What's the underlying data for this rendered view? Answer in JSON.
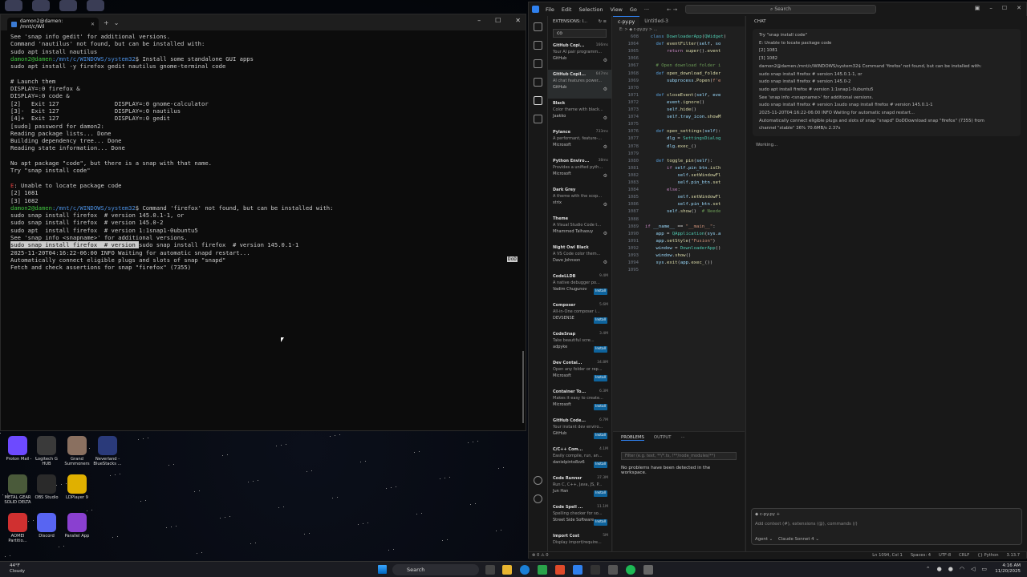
{
  "terminal": {
    "tab_title": "damon2@damen: /mnt/c/WIl",
    "lines": [
      {
        "t": "See 'snap info gedit' for additional versions."
      },
      {
        "t": "Command 'nautilus' not found, but can be installed with:"
      },
      {
        "t": "sudo apt install nautilus"
      },
      {
        "prompt": "damon2@damen",
        "path": ":/mnt/c/WINDOWS/system32",
        "cmd": "$ Install some standalone GUI apps"
      },
      {
        "t": "sudo apt install -y firefox gedit nautilus gnome-terminal code"
      },
      {
        "t": ""
      },
      {
        "t": "# Launch them"
      },
      {
        "t": "DISPLAY=:0 firefox &"
      },
      {
        "t": "DISPLAY=:0 code &"
      },
      {
        "t": "[2]   Exit 127                DISPLAY=:0 gnome-calculator"
      },
      {
        "t": "[3]-  Exit 127                DISPLAY=:0 nautilus"
      },
      {
        "t": "[4]+  Exit 127                DISPLAY=:0 gedit"
      },
      {
        "t": "[sudo] password for damon2:"
      },
      {
        "t": "Reading package lists... Done"
      },
      {
        "t": "Building dependency tree... Done"
      },
      {
        "t": "Reading state information... Done"
      },
      {
        "t": ""
      },
      {
        "t": "No apt package \"code\", but there is a snap with that name."
      },
      {
        "t": "Try \"snap install code\""
      },
      {
        "t": ""
      },
      {
        "err": "E",
        "t": ": Unable to locate package code"
      },
      {
        "t": "[2] 1081"
      },
      {
        "t": "[3] 1082"
      },
      {
        "prompt": "damon2@damen",
        "path": ":/mnt/c/WINDOWS/system32",
        "cmd": "$ Command 'firefox' not found, but can be installed with:"
      },
      {
        "t": "sudo snap install firefox  # version 145.0.1-1, or"
      },
      {
        "t": "sudo snap install firefox  # version 145.0-2"
      },
      {
        "t": "sudo apt  install firefox  # version 1:1snap1-0ubuntu5"
      },
      {
        "t": "See 'snap info <snapname>' for additional versions."
      },
      {
        "sel": "sudo snap install firefox  # version ",
        "t": "sudo snap install firefox  # version 145.0.1-1"
      },
      {
        "t": "2025-11-20T04:16:22-06:00 INFO Waiting for automatic snapd restart..."
      },
      {
        "t": "Automatically connect eligible plugs and slots of snap \"snapd\""
      },
      {
        "t": "Fetch and check assertions for snap \"firefox\" (7355)"
      }
    ],
    "dop_label": "DoD"
  },
  "desktop_icons": [
    {
      "label": "Proton Mail",
      "color": "#6d4aff"
    },
    {
      "label": "Logitech G HUB",
      "color": "#3a3a3a"
    },
    {
      "label": "Grand Summoners",
      "color": "#8a7060"
    },
    {
      "label": "Neverland - BlueStacks ...",
      "color": "#2a3a7a"
    },
    {
      "label": "METAL GEAR SOLID DELTA",
      "color": "#4a5a3a"
    },
    {
      "label": "OBS Studio",
      "color": "#2a2a2a"
    },
    {
      "label": "LDPlayer 9",
      "color": "#e0b000"
    },
    {
      "label": "AOMEI Partitio...",
      "color": "#d03030"
    },
    {
      "label": "Discord",
      "color": "#5865f2"
    },
    {
      "label": "Parallel App",
      "color": "#8a40d0"
    }
  ],
  "vscode": {
    "menu": [
      "File",
      "Edit",
      "Selection",
      "View",
      "Go",
      "···"
    ],
    "search_placeholder": "Search",
    "extensions_header": "EXTENSIONS: I...",
    "extensions_search": "co",
    "extensions": [
      {
        "name": "GitHub Copi...",
        "desc": "Your AI pair programm...",
        "pub": "GitHub",
        "dl": "166ms",
        "action": "gear"
      },
      {
        "name": "GitHub Copil...",
        "desc": "AI chat features power...",
        "pub": "GitHub",
        "dl": "647ms",
        "action": "gear",
        "selected": true
      },
      {
        "name": "Black",
        "desc": "Color theme with black...",
        "pub": "Jaakko",
        "dl": "",
        "action": "gear"
      },
      {
        "name": "Pylance",
        "desc": "A performant, feature-...",
        "pub": "Microsoft",
        "dl": "733ms",
        "action": "gear"
      },
      {
        "name": "Python Enviro...",
        "desc": "Provides a unified pyth...",
        "pub": "Microsoft",
        "dl": "38ms",
        "action": "gear"
      },
      {
        "name": "Dark Grey",
        "desc": "A theme with the scop...",
        "pub": "strix",
        "dl": "",
        "action": "gear"
      },
      {
        "name": "Theme",
        "desc": "A Visual Studio Code t...",
        "pub": "Mhammed Talhaouy",
        "dl": "",
        "action": "gear"
      },
      {
        "name": "Night Owl Black",
        "desc": "A VS Code color them...",
        "pub": "Dave Johnson",
        "dl": "",
        "action": "gear"
      },
      {
        "name": "CodeLLDB",
        "desc": "A native debugger po...",
        "pub": "Vadim Chugunov",
        "dl": "9.4M",
        "action": "Install"
      },
      {
        "name": "Composer",
        "desc": "All-in-One composer i...",
        "pub": "DEVSENSE",
        "dl": "5.6M",
        "action": "Install"
      },
      {
        "name": "CodeSnap",
        "desc": "Take beautiful scre...",
        "pub": "adpyke",
        "dl": "3.4M",
        "action": "Install"
      },
      {
        "name": "Dev Contai...",
        "desc": "Open any folder or rep...",
        "pub": "Microsoft",
        "dl": "34.8M",
        "action": "Install"
      },
      {
        "name": "Container To...",
        "desc": "Makes it easy to create...",
        "pub": "Microsoft",
        "dl": "6.3M",
        "action": "Install"
      },
      {
        "name": "GitHub Code...",
        "desc": "Your instant dev enviro...",
        "pub": "GitHub",
        "dl": "6.7M",
        "action": "Install"
      },
      {
        "name": "C/C++ Com...",
        "desc": "Easily compile, run, an...",
        "pub": "danielpinto8zz6",
        "dl": "4.1M",
        "action": "Install"
      },
      {
        "name": "Code Runner",
        "desc": "Run C, C++, Java, JS, P...",
        "pub": "Jun Han",
        "dl": "37.3M",
        "action": "Install"
      },
      {
        "name": "Code Spell ...",
        "desc": "Spelling checker for so...",
        "pub": "Street Side Software",
        "dl": "11.1M",
        "action": "Install"
      },
      {
        "name": "Import Cost",
        "desc": "Display import/require...",
        "pub": "",
        "dl": "5M",
        "action": ""
      }
    ],
    "tabs": [
      {
        "label": "c-py.py",
        "active": true
      },
      {
        "label": "Untitled-3",
        "active": false
      }
    ],
    "breadcrumb": "E: > ◆ c-py.py > ...",
    "code": [
      {
        "n": "608",
        "html": "  <span class='kw'>class</span> <span class='cls'>DownloaderApp</span>(<span class='cls'>QWidget</span>)"
      },
      {
        "n": "1064",
        "html": "    <span class='kw'>def</span> <span class='fn'>eventFilter</span>(<span class='vr'>self</span>, <span class='vr'>so</span>"
      },
      {
        "n": "1065",
        "html": "        <span class='pp'>return</span> <span class='fn'>super</span>().<span class='fn'>event</span>"
      },
      {
        "n": "1066",
        "html": ""
      },
      {
        "n": "1067",
        "html": "    <span class='cm'># Open download folder i</span>"
      },
      {
        "n": "1068",
        "html": "    <span class='kw'>def</span> <span class='fn'>open_download_folder</span>"
      },
      {
        "n": "1069",
        "html": "        <span class='vr'>subprocess</span>.<span class='fn'>Popen</span>(<span class='str'>f'e</span>"
      },
      {
        "n": "1070",
        "html": ""
      },
      {
        "n": "1071",
        "html": "    <span class='kw'>def</span> <span class='fn'>closeEvent</span>(<span class='vr'>self</span>, <span class='vr'>eve</span>"
      },
      {
        "n": "1072",
        "html": "        <span class='vr'>event</span>.<span class='fn'>ignore</span>()"
      },
      {
        "n": "1073",
        "html": "        <span class='vr'>self</span>.<span class='fn'>hide</span>()"
      },
      {
        "n": "1074",
        "html": "        <span class='vr'>self</span>.<span class='vr'>tray_icon</span>.<span class='fn'>showM</span>"
      },
      {
        "n": "1075",
        "html": ""
      },
      {
        "n": "1076",
        "html": "    <span class='kw'>def</span> <span class='fn'>open_settings</span>(<span class='vr'>self</span>):"
      },
      {
        "n": "1077",
        "html": "        <span class='vr'>dlg</span> = <span class='cls'>SettingsDialog</span>"
      },
      {
        "n": "1078",
        "html": "        <span class='vr'>dlg</span>.<span class='fn'>exec_</span>()"
      },
      {
        "n": "1079",
        "html": ""
      },
      {
        "n": "1080",
        "html": "    <span class='kw'>def</span> <span class='fn'>toggle_pin</span>(<span class='vr'>self</span>):"
      },
      {
        "n": "1081",
        "html": "        <span class='pp'>if</span> <span class='vr'>self</span>.<span class='vr'>pin_btn</span>.<span class='fn'>isCh</span>"
      },
      {
        "n": "1082",
        "html": "            <span class='vr'>self</span>.<span class='fn'>setWindowFl</span>"
      },
      {
        "n": "1083",
        "html": "            <span class='vr'>self</span>.<span class='vr'>pin_btn</span>.<span class='fn'>set</span>"
      },
      {
        "n": "1084",
        "html": "        <span class='pp'>else</span>:"
      },
      {
        "n": "1085",
        "html": "            <span class='vr'>self</span>.<span class='fn'>setWindowFl</span>"
      },
      {
        "n": "1086",
        "html": "            <span class='vr'>self</span>.<span class='vr'>pin_btn</span>.<span class='fn'>set</span>"
      },
      {
        "n": "1087",
        "html": "        <span class='vr'>self</span>.<span class='fn'>show</span>()  <span class='cm'># Neede</span>"
      },
      {
        "n": "1088",
        "html": ""
      },
      {
        "n": "1089",
        "html": "<span class='pp'>if</span> <span class='vr'>__name__</span> == <span class='str'>\"__main__\"</span>:"
      },
      {
        "n": "1090",
        "html": "    <span class='vr'>app</span> = <span class='cls'>QApplication</span>(<span class='vr'>sys</span>.<span class='vr'>a</span>"
      },
      {
        "n": "1091",
        "html": "    <span class='vr'>app</span>.<span class='fn'>setStyle</span>(<span class='str'>\"Fusion\"</span>)"
      },
      {
        "n": "1092",
        "html": "    <span class='vr'>window</span> = <span class='cls'>DownloaderApp</span>()"
      },
      {
        "n": "1093",
        "html": "    <span class='vr'>window</span>.<span class='fn'>show</span>()"
      },
      {
        "n": "1094",
        "html": "    <span class='vr'>sys</span>.<span class='fn'>exit</span>(<span class='vr'>app</span>.<span class='fn'>exec_</span>())"
      },
      {
        "n": "1095",
        "html": ""
      }
    ],
    "panel_tabs": [
      "PROBLEMS",
      "OUTPUT",
      "···"
    ],
    "panel_filter": "Filter (e.g. text, **/*.ts, !**/node_modules/**)",
    "panel_msg": "No problems have been detected in the workspace.",
    "chat_title": "CHAT",
    "chat_lines": [
      "Try \"snap install code\"",
      "",
      "E: Unable to locate package code",
      "[2] 1081",
      "[3] 1082",
      "damon2@damen:/mnt/c/WINDOWS/system32$ Command 'firefox' not found, but can be installed with:",
      "sudo snap install firefox # version 145.0.1-1, or",
      "sudo snap install firefox # version 145.0-2",
      "sudo apt install firefox # version 1:1snap1-0ubuntu5",
      "See 'snap info <snapname>' for additional versions.",
      "sudo snap install firefox # version 1sudo snap install firefox # version 145.0.1-1",
      "2025-11-20T04:16:22-06:00 INFO Waiting for automatic snapd restart...",
      "Automatically connect eligible plugs and slots of snap \"snapd\" DoDDownload snap \"firefox\" (7355) from",
      "channel \"stable\" 36% 70.6MB/s 2.37s"
    ],
    "working": "Working...",
    "chat_context": "◆ c-py.py +",
    "chat_placeholder": "Add context (#), extensions (@), commands (/)",
    "chat_mode": "Agent ⌄",
    "chat_model": "Claude Sonnet 4 ⌄",
    "status_left": "⊗ 0 ⚠ 0",
    "status_right": [
      "Ln 1094, Col 1",
      "Spaces: 4",
      "UTF-8",
      "CRLF",
      "{} Python",
      "3.13.7"
    ]
  },
  "taskbar": {
    "temp": "44°F",
    "weather": "Cloudy",
    "search": "Search",
    "time": "4:16 AM",
    "date": "11/20/2025"
  }
}
